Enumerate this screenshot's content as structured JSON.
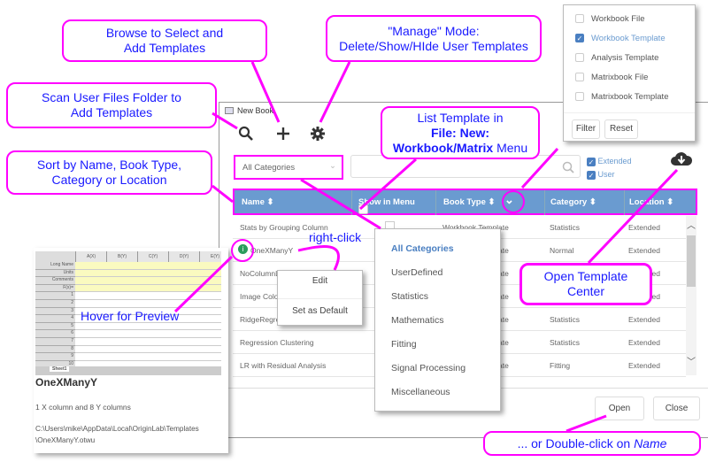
{
  "window": {
    "title": "New Book",
    "close": "×"
  },
  "toolbar": {
    "search_icon": "search-icon",
    "add_icon": "plus-icon",
    "manage_icon": "gear-icon"
  },
  "category_select": {
    "value": "All Categories"
  },
  "search": {
    "placeholder": ""
  },
  "filters": {
    "extended": {
      "label": "Extended",
      "checked": true
    },
    "user": {
      "label": "User",
      "checked": true
    }
  },
  "table": {
    "headers": [
      "Name",
      "Show in Menu",
      "Book Type",
      "Category",
      "Location"
    ],
    "rows": [
      {
        "name": "Stats by Grouping Column",
        "type": "Workbook Template",
        "category": "Statistics",
        "location": "Extended"
      },
      {
        "name": "OneXManyY",
        "type": "Workbook Template",
        "category": "Normal",
        "location": "Extended"
      },
      {
        "name": "NoColumnLa",
        "type": "Workbook Template",
        "category": "",
        "location": "Extended"
      },
      {
        "name": "Image Colors",
        "type": "Workbook Template",
        "category": "",
        "location": "Extended"
      },
      {
        "name": "RidgeRegres",
        "type": "Workbook Template",
        "category": "Statistics",
        "location": "Extended"
      },
      {
        "name": "Regression Clustering",
        "type": "Workbook Template",
        "category": "Statistics",
        "location": "Extended"
      },
      {
        "name": "LR with Residual Analysis",
        "type": "Workbook Template",
        "category": "Fitting",
        "location": "Extended"
      }
    ]
  },
  "category_menu": [
    "All Categories",
    "UserDefined",
    "Statistics",
    "Mathematics",
    "Fitting",
    "Signal Processing",
    "Miscellaneous"
  ],
  "context_menu": [
    "Edit",
    "Set as Default"
  ],
  "booktype_filter": {
    "items": [
      {
        "label": "Workbook File",
        "checked": false
      },
      {
        "label": "Workbook Template",
        "checked": true
      },
      {
        "label": "Analysis Template",
        "checked": false
      },
      {
        "label": "Matrixbook File",
        "checked": false
      },
      {
        "label": "Matrixbook Template",
        "checked": false
      }
    ],
    "filter": "Filter",
    "reset": "Reset"
  },
  "preview": {
    "columns": [
      "A(X)",
      "B(Y)",
      "C(Y)",
      "D(Y)",
      "E(Y)"
    ],
    "row_labels": [
      "Long Name",
      "Units",
      "Comments",
      "F(x)=",
      "1",
      "2",
      "3",
      "4",
      "5",
      "6",
      "7",
      "8",
      "9",
      "10"
    ],
    "sheet_tab": "Sheet1",
    "name": "OneXManyY",
    "description": "1 X column and 8 Y columns",
    "path1": "C:\\Users\\mike\\AppData\\Local\\OriginLab\\Templates",
    "path2": "\\OneXManyY.otwu"
  },
  "buttons": {
    "open": "Open",
    "close": "Close"
  },
  "annotations": {
    "browse": [
      "Browse to Select and",
      "Add Templates"
    ],
    "manage": [
      "\"Manage\" Mode:",
      "Delete/Show/HIde User Templates"
    ],
    "scan": [
      "Scan User Files Folder to",
      "Add Templates"
    ],
    "sort": [
      "Sort by Name, Book Type,",
      "Category or Location"
    ],
    "list": [
      "List Template in",
      "File: New:",
      "Workbook/Matrix",
      "Menu"
    ],
    "template_center": [
      "Open Template",
      "Center"
    ],
    "double_click": [
      "... or Double-click on ",
      "Name"
    ],
    "right_click": "right-click",
    "hover": "Hover for Preview"
  },
  "colors": {
    "header": "#6a9bd0",
    "annotation": "#ff00ff",
    "annotation_text": "#1a1aff",
    "accent": "#4a7fc1"
  }
}
